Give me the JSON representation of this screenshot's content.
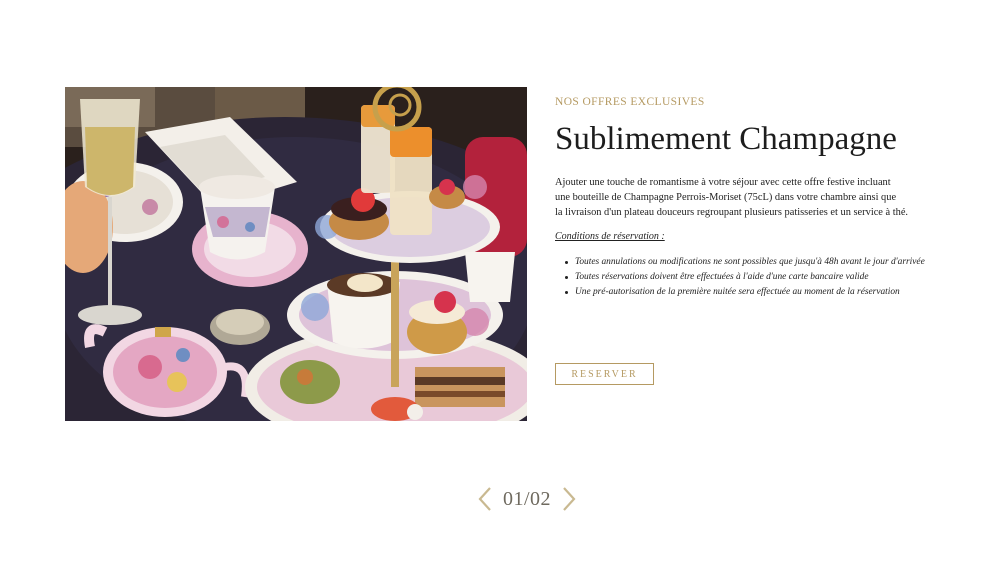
{
  "offer": {
    "eyebrow": "NOS OFFRES EXCLUSIVES",
    "title": "Sublimement Champagne",
    "description_lines": [
      "Ajouter une touche de romantisme à votre séjour avec cette offre festive incluant",
      "une bouteille de Champagne Perrois-Moriset (75cL) dans votre chambre ainsi que",
      "la livraison d'un plateau douceurs regroupant plusieurs patisseries et un service à thé."
    ],
    "conditions_title": "Conditions de réservation :",
    "conditions": [
      "Toutes annulations ou modifications ne sont possibles que jusqu'à 48h avant le jour d'arrivée",
      "Toutes réservations doivent être effectuées à l'aide d'une carte bancaire valide",
      "Une pré-autorisation de la première nuitée sera effectuée au moment de la réservation"
    ],
    "reserve_label": "RESERVER"
  },
  "pager": {
    "counter": "01/02",
    "prev_icon": "chevron-left-icon",
    "next_icon": "chevron-right-icon"
  },
  "colors": {
    "accent": "#b59a62",
    "text": "#1d1d1d",
    "pager_text": "#6f6a5f"
  }
}
